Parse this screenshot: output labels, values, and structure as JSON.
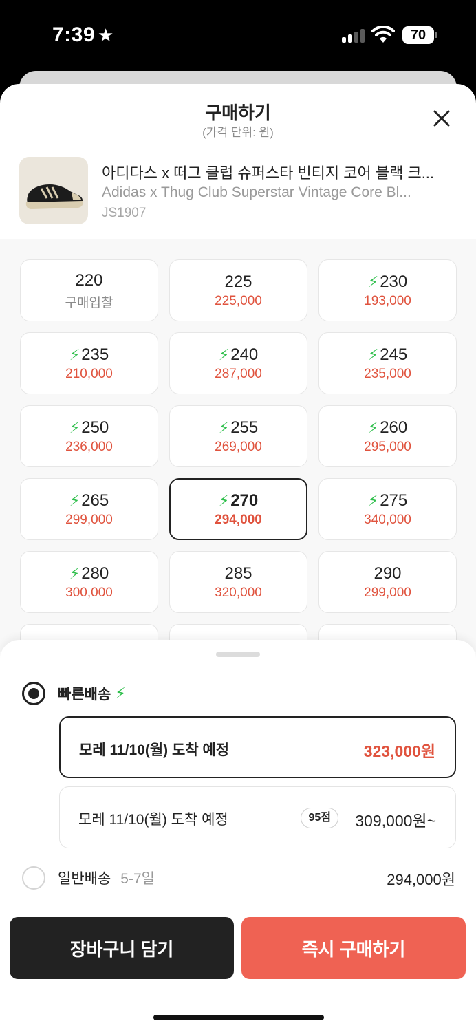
{
  "status": {
    "time": "7:39",
    "battery": "70"
  },
  "header": {
    "title": "구매하기",
    "subtitle": "(가격 단위: 원)"
  },
  "product": {
    "name_ko": "아디다스 x 떠그 클럽 슈퍼스타 빈티지 코어 블랙 크...",
    "name_en": "Adidas x Thug Club Superstar Vintage Core Bl...",
    "code": "JS1907"
  },
  "sizes": [
    {
      "size": "220",
      "price": "구매입찰",
      "fast": false
    },
    {
      "size": "225",
      "price": "225,000",
      "fast": false
    },
    {
      "size": "230",
      "price": "193,000",
      "fast": true
    },
    {
      "size": "235",
      "price": "210,000",
      "fast": true
    },
    {
      "size": "240",
      "price": "287,000",
      "fast": true
    },
    {
      "size": "245",
      "price": "235,000",
      "fast": true
    },
    {
      "size": "250",
      "price": "236,000",
      "fast": true
    },
    {
      "size": "255",
      "price": "269,000",
      "fast": true
    },
    {
      "size": "260",
      "price": "295,000",
      "fast": true
    },
    {
      "size": "265",
      "price": "299,000",
      "fast": true
    },
    {
      "size": "270",
      "price": "294,000",
      "fast": true,
      "selected": true
    },
    {
      "size": "275",
      "price": "340,000",
      "fast": true
    },
    {
      "size": "280",
      "price": "300,000",
      "fast": true
    },
    {
      "size": "285",
      "price": "320,000",
      "fast": false
    },
    {
      "size": "290",
      "price": "299,000",
      "fast": false
    }
  ],
  "delivery": {
    "fast_label": "빠른배송",
    "options": [
      {
        "label": "모레 11/10(월) 도착 예정",
        "price": "323,000원",
        "selected": true
      },
      {
        "label": "모레 11/10(월) 도착 예정",
        "score": "95점",
        "price": "309,000원~",
        "selected": false
      }
    ],
    "standard_label": "일반배송",
    "standard_days": "5-7일",
    "standard_price": "294,000원"
  },
  "actions": {
    "cart": "장바구니 담기",
    "buy": "즉시 구매하기"
  },
  "colors": {
    "accent_red": "#ef6253",
    "price_red": "#e0533e",
    "bolt_green": "#2fbf4c"
  }
}
